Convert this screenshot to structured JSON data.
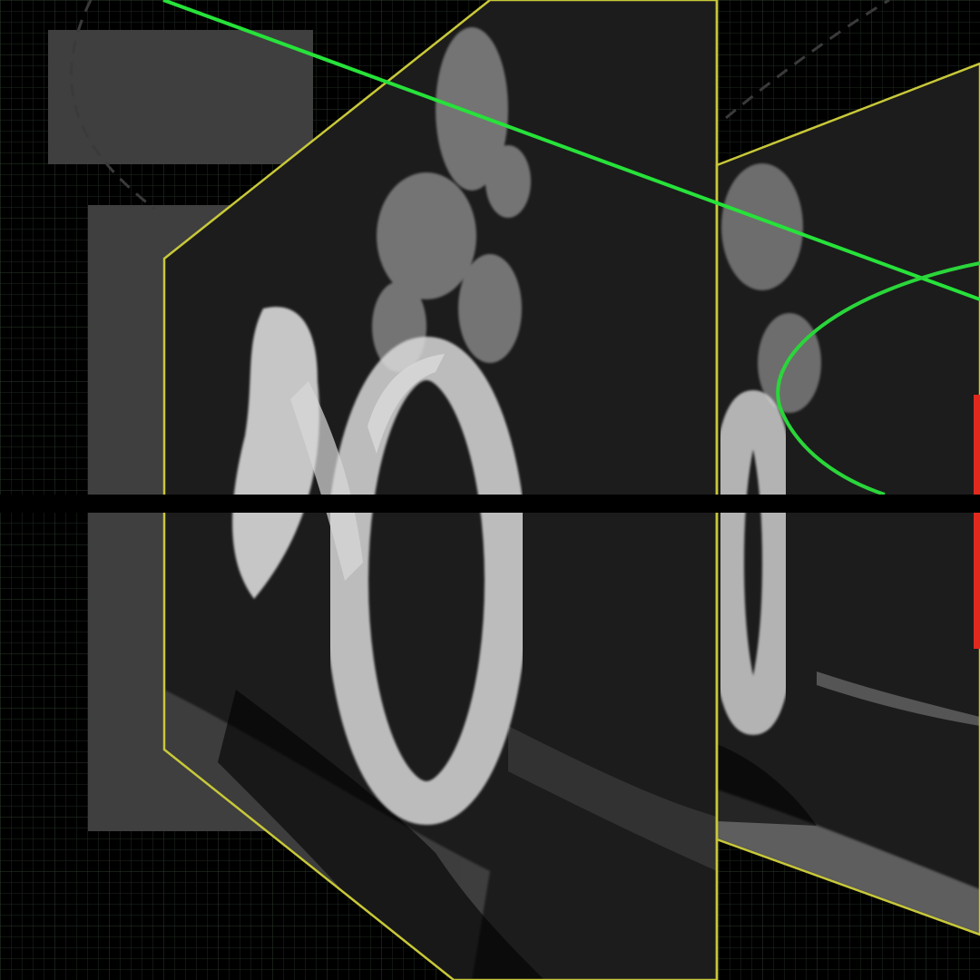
{
  "viewport": {
    "background": "#000000",
    "grid_color": "#1f2a1f",
    "grid_major_color": "#2d3a2d"
  },
  "panels": {
    "left_frame_color": "#c8c83a",
    "right_frame_color": "#c8c83a",
    "panel_fill": "#1c1c1c",
    "stone_color": "#d9d9d9",
    "foliage_color": "#bdbdbd",
    "backdrop_color": "#3f3f3f"
  },
  "guides": {
    "line_color": "#27e23a",
    "scanline_color": "#2bff45",
    "ellipse_color": "#2ad63a"
  },
  "indicator": {
    "color": "#e02a1e"
  }
}
